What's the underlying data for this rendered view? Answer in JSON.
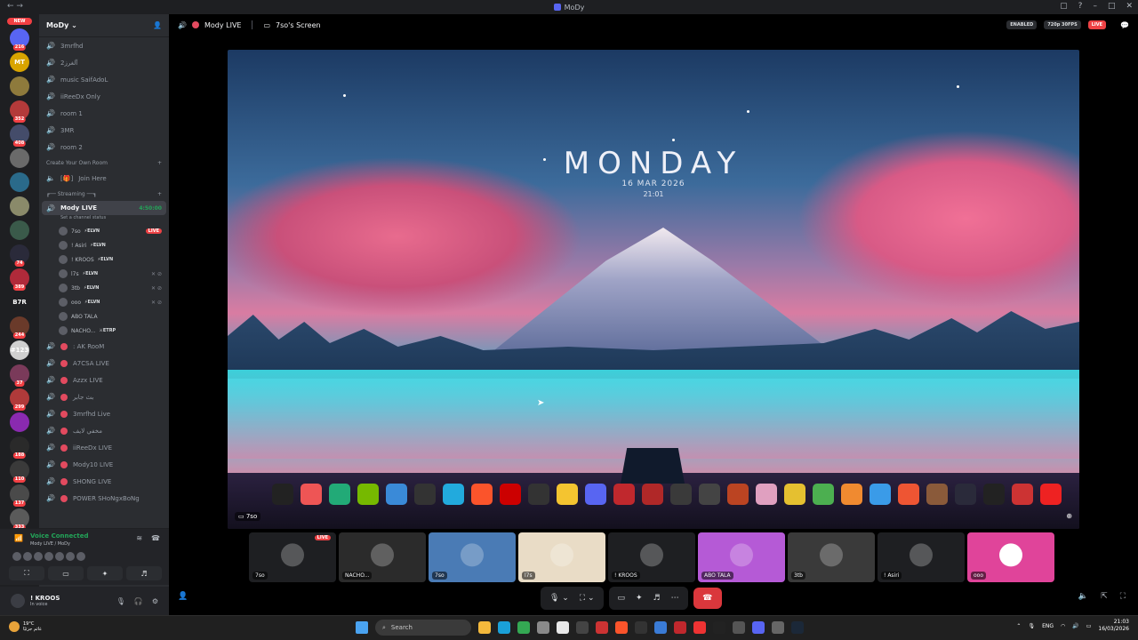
{
  "window": {
    "title": "MoDy"
  },
  "servers": {
    "new_badge": "NEW",
    "items": [
      {
        "color": "#5865f2",
        "badge": "216"
      },
      {
        "color": "#d8a400",
        "text": "MT"
      },
      {
        "color": "#8e7a3c"
      },
      {
        "color": "#b33a3a",
        "badge": "352"
      },
      {
        "color": "#444c6a",
        "badge": "408"
      },
      {
        "color": "#6a6a6a"
      },
      {
        "color": "#2a6a8a"
      },
      {
        "color": "#8a8a6a"
      },
      {
        "color": "#3a5a4a"
      },
      {
        "color": "#2a2a3a",
        "badge": "74"
      },
      {
        "color": "#b02a3a",
        "badge": "389"
      },
      {
        "color": "#1e1f22",
        "text": "B7R"
      },
      {
        "color": "#6a3a2a",
        "badge": "244"
      },
      {
        "color": "#d0d0d0",
        "text": "#123"
      },
      {
        "color": "#7a3a5a",
        "badge": "37"
      },
      {
        "color": "#b03a3a",
        "badge": "299"
      },
      {
        "color": "#8a2ab0"
      },
      {
        "color": "#2a2a2a",
        "badge": "188"
      },
      {
        "color": "#3a3a3a",
        "badge": "110"
      },
      {
        "color": "#4a4a4a",
        "badge": "137"
      },
      {
        "color": "#5a5a5a",
        "badge": "333"
      }
    ],
    "bottom_badge": "NEW"
  },
  "guild": {
    "name": "MoDy",
    "chevron": "chevron-down-icon"
  },
  "channels": [
    {
      "name": "3mrfhd"
    },
    {
      "name": "آلغرز2"
    },
    {
      "name": "music SaifAdoL"
    },
    {
      "name": "iiReeDx Only"
    },
    {
      "name": "room 1"
    },
    {
      "name": "3MR"
    },
    {
      "name": "room 2"
    }
  ],
  "category_own_room": {
    "label": "Create Your Own Room",
    "channel": "Join Here",
    "prefix": "[🎁]"
  },
  "category_streaming": {
    "label": "┏── Streaming ──┓"
  },
  "active_channel": {
    "name": "Mody LIVE",
    "timer": "4:50:00",
    "status": "Set a channel status"
  },
  "voice_users": [
    {
      "name": "7so",
      "tag": "⚡ELVN",
      "live": "LIVE"
    },
    {
      "name": "! Asiri",
      "tag": "⚡ELVN"
    },
    {
      "name": "! KROOS",
      "tag": "⚡ELVN"
    },
    {
      "name": "l7s",
      "tag": "⚡ELVN"
    },
    {
      "name": "3tb",
      "tag": "⚡ELVN"
    },
    {
      "name": "ooo",
      "tag": "⚡ELVN"
    },
    {
      "name": "ABO TALA",
      "tag": ""
    },
    {
      "name": "NACHO...",
      "tag": "⚔ETRP"
    }
  ],
  "more_channels": [
    {
      "name": ": AK RooM"
    },
    {
      "name": "A7CSA LIVE"
    },
    {
      "name": "Azzx LIVE"
    },
    {
      "name": "بث جابر"
    },
    {
      "name": "3mrfhd Live"
    },
    {
      "name": "مخفي لايف"
    },
    {
      "name": "iiReeDx LIVE"
    },
    {
      "name": "Mody10 LIVE"
    },
    {
      "name": "SHONG LIVE"
    },
    {
      "name": "POWER SHoNgxBoNg"
    }
  ],
  "voice_panel": {
    "title": "Voice Connected",
    "subtitle": "Mody LIVE / MoDy"
  },
  "user_panel": {
    "name": "! KROOS",
    "status": "In voice"
  },
  "stage_bar": {
    "channel": "Mody LIVE",
    "screen": "7so's Screen",
    "enabled": "ENABLED",
    "quality": "720p 30FPS",
    "live": "LIVE"
  },
  "stream": {
    "day": "MONDAY",
    "date": "16 MAR 2026",
    "time": "21:01",
    "label": "7so"
  },
  "tiles": [
    {
      "label": "7so",
      "live": "LIVE",
      "color": "#1e1f22"
    },
    {
      "label": "NACHO...",
      "color": "#2b2b2b"
    },
    {
      "label": "7so",
      "color": "#4a7bb5"
    },
    {
      "label": "l7s",
      "color": "#e9dcc6"
    },
    {
      "label": "! KROOS",
      "color": "#1e1f22"
    },
    {
      "label": "ABO TALA",
      "color": "#b55ad6"
    },
    {
      "label": "3tb",
      "color": "#3a3a3a"
    },
    {
      "label": "! Asiri",
      "color": "#1e1f22"
    },
    {
      "label": "ooo",
      "color": "#e0449a"
    }
  ],
  "taskbar": {
    "weather_temp": "19°C",
    "weather_desc": "غائم جزئيًا",
    "search": "Search",
    "lang": "ENG",
    "clock_time": "21:03",
    "clock_date": "16/03/2026"
  }
}
